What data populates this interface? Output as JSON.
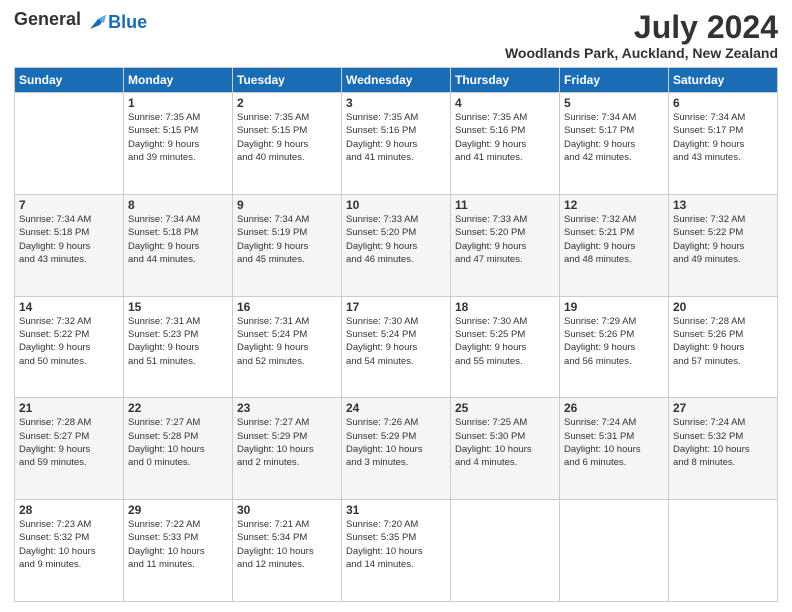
{
  "header": {
    "logo_general": "General",
    "logo_blue": "Blue",
    "month_title": "July 2024",
    "location": "Woodlands Park, Auckland, New Zealand"
  },
  "days_of_week": [
    "Sunday",
    "Monday",
    "Tuesday",
    "Wednesday",
    "Thursday",
    "Friday",
    "Saturday"
  ],
  "weeks": [
    [
      {
        "day": "",
        "info": ""
      },
      {
        "day": "1",
        "info": "Sunrise: 7:35 AM\nSunset: 5:15 PM\nDaylight: 9 hours\nand 39 minutes."
      },
      {
        "day": "2",
        "info": "Sunrise: 7:35 AM\nSunset: 5:15 PM\nDaylight: 9 hours\nand 40 minutes."
      },
      {
        "day": "3",
        "info": "Sunrise: 7:35 AM\nSunset: 5:16 PM\nDaylight: 9 hours\nand 41 minutes."
      },
      {
        "day": "4",
        "info": "Sunrise: 7:35 AM\nSunset: 5:16 PM\nDaylight: 9 hours\nand 41 minutes."
      },
      {
        "day": "5",
        "info": "Sunrise: 7:34 AM\nSunset: 5:17 PM\nDaylight: 9 hours\nand 42 minutes."
      },
      {
        "day": "6",
        "info": "Sunrise: 7:34 AM\nSunset: 5:17 PM\nDaylight: 9 hours\nand 43 minutes."
      }
    ],
    [
      {
        "day": "7",
        "info": "Sunrise: 7:34 AM\nSunset: 5:18 PM\nDaylight: 9 hours\nand 43 minutes."
      },
      {
        "day": "8",
        "info": "Sunrise: 7:34 AM\nSunset: 5:18 PM\nDaylight: 9 hours\nand 44 minutes."
      },
      {
        "day": "9",
        "info": "Sunrise: 7:34 AM\nSunset: 5:19 PM\nDaylight: 9 hours\nand 45 minutes."
      },
      {
        "day": "10",
        "info": "Sunrise: 7:33 AM\nSunset: 5:20 PM\nDaylight: 9 hours\nand 46 minutes."
      },
      {
        "day": "11",
        "info": "Sunrise: 7:33 AM\nSunset: 5:20 PM\nDaylight: 9 hours\nand 47 minutes."
      },
      {
        "day": "12",
        "info": "Sunrise: 7:32 AM\nSunset: 5:21 PM\nDaylight: 9 hours\nand 48 minutes."
      },
      {
        "day": "13",
        "info": "Sunrise: 7:32 AM\nSunset: 5:22 PM\nDaylight: 9 hours\nand 49 minutes."
      }
    ],
    [
      {
        "day": "14",
        "info": "Sunrise: 7:32 AM\nSunset: 5:22 PM\nDaylight: 9 hours\nand 50 minutes."
      },
      {
        "day": "15",
        "info": "Sunrise: 7:31 AM\nSunset: 5:23 PM\nDaylight: 9 hours\nand 51 minutes."
      },
      {
        "day": "16",
        "info": "Sunrise: 7:31 AM\nSunset: 5:24 PM\nDaylight: 9 hours\nand 52 minutes."
      },
      {
        "day": "17",
        "info": "Sunrise: 7:30 AM\nSunset: 5:24 PM\nDaylight: 9 hours\nand 54 minutes."
      },
      {
        "day": "18",
        "info": "Sunrise: 7:30 AM\nSunset: 5:25 PM\nDaylight: 9 hours\nand 55 minutes."
      },
      {
        "day": "19",
        "info": "Sunrise: 7:29 AM\nSunset: 5:26 PM\nDaylight: 9 hours\nand 56 minutes."
      },
      {
        "day": "20",
        "info": "Sunrise: 7:28 AM\nSunset: 5:26 PM\nDaylight: 9 hours\nand 57 minutes."
      }
    ],
    [
      {
        "day": "21",
        "info": "Sunrise: 7:28 AM\nSunset: 5:27 PM\nDaylight: 9 hours\nand 59 minutes."
      },
      {
        "day": "22",
        "info": "Sunrise: 7:27 AM\nSunset: 5:28 PM\nDaylight: 10 hours\nand 0 minutes."
      },
      {
        "day": "23",
        "info": "Sunrise: 7:27 AM\nSunset: 5:29 PM\nDaylight: 10 hours\nand 2 minutes."
      },
      {
        "day": "24",
        "info": "Sunrise: 7:26 AM\nSunset: 5:29 PM\nDaylight: 10 hours\nand 3 minutes."
      },
      {
        "day": "25",
        "info": "Sunrise: 7:25 AM\nSunset: 5:30 PM\nDaylight: 10 hours\nand 4 minutes."
      },
      {
        "day": "26",
        "info": "Sunrise: 7:24 AM\nSunset: 5:31 PM\nDaylight: 10 hours\nand 6 minutes."
      },
      {
        "day": "27",
        "info": "Sunrise: 7:24 AM\nSunset: 5:32 PM\nDaylight: 10 hours\nand 8 minutes."
      }
    ],
    [
      {
        "day": "28",
        "info": "Sunrise: 7:23 AM\nSunset: 5:32 PM\nDaylight: 10 hours\nand 9 minutes."
      },
      {
        "day": "29",
        "info": "Sunrise: 7:22 AM\nSunset: 5:33 PM\nDaylight: 10 hours\nand 11 minutes."
      },
      {
        "day": "30",
        "info": "Sunrise: 7:21 AM\nSunset: 5:34 PM\nDaylight: 10 hours\nand 12 minutes."
      },
      {
        "day": "31",
        "info": "Sunrise: 7:20 AM\nSunset: 5:35 PM\nDaylight: 10 hours\nand 14 minutes."
      },
      {
        "day": "",
        "info": ""
      },
      {
        "day": "",
        "info": ""
      },
      {
        "day": "",
        "info": ""
      }
    ]
  ]
}
